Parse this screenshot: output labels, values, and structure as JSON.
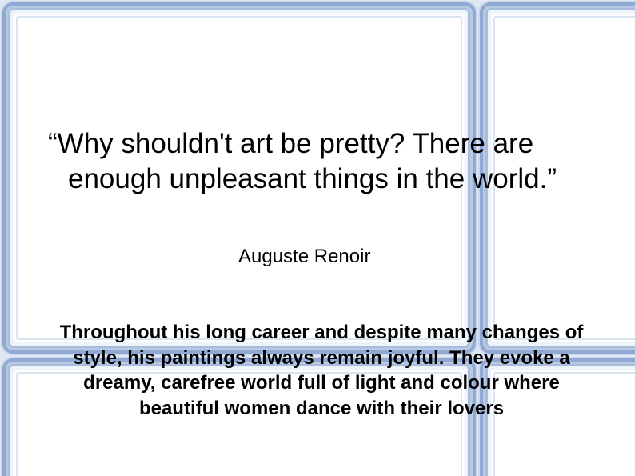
{
  "slide": {
    "quote": "“Why shouldn't art be pretty? There are enough unpleasant things in the world.”",
    "author": "Auguste Renoir",
    "description": "Throughout his long career and despite many changes of style, his paintings always remain joyful. They evoke a dreamy, carefree world full of light and colour where beautiful women dance with their lovers"
  },
  "colors": {
    "frame_blue": "#90a9d2",
    "frame_light": "#c9d6eb",
    "pane_white": "#ffffff",
    "text": "#000000"
  }
}
